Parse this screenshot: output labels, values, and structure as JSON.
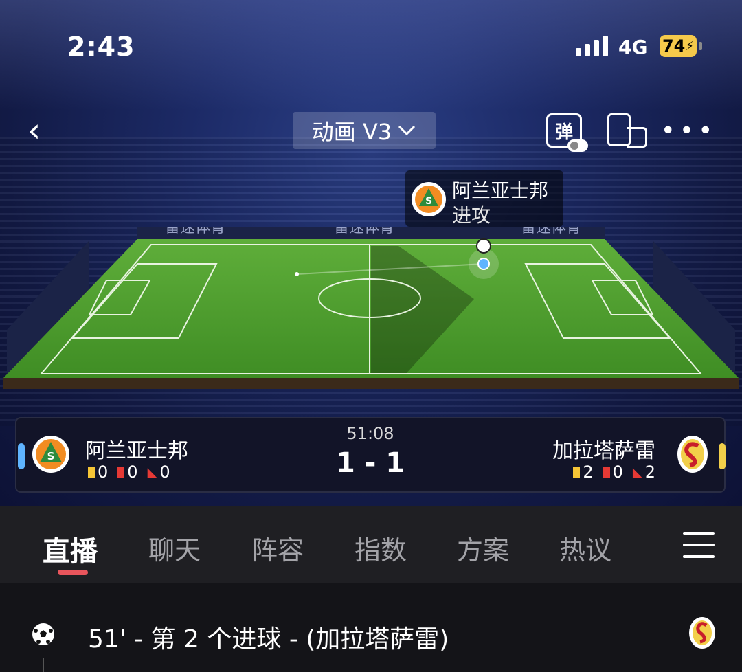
{
  "status_bar": {
    "time": "2:43",
    "network": "4G",
    "battery": "74"
  },
  "toolbar": {
    "version_label": "动画 V3",
    "danmu_label": "弹"
  },
  "field": {
    "brand_text": "雷速体育",
    "popup": {
      "team": "阿兰亚士邦",
      "action": "进攻"
    }
  },
  "match": {
    "minute": "51:08",
    "score": "1 - 1",
    "home": {
      "name": "阿兰亚士邦",
      "yellow": "0",
      "red": "0",
      "corners": "0",
      "color": "#5fb4ff"
    },
    "away": {
      "name": "加拉塔萨雷",
      "yellow": "2",
      "red": "0",
      "corners": "2",
      "color": "#f2cf4a"
    }
  },
  "tabs": [
    {
      "label": "直播",
      "active": true
    },
    {
      "label": "聊天"
    },
    {
      "label": "阵容"
    },
    {
      "label": "指数"
    },
    {
      "label": "方案"
    },
    {
      "label": "热议"
    }
  ],
  "events": [
    {
      "text": "51' - 第 2 个进球 - (加拉塔萨雷)",
      "icon": "soccer-ball-icon"
    }
  ]
}
